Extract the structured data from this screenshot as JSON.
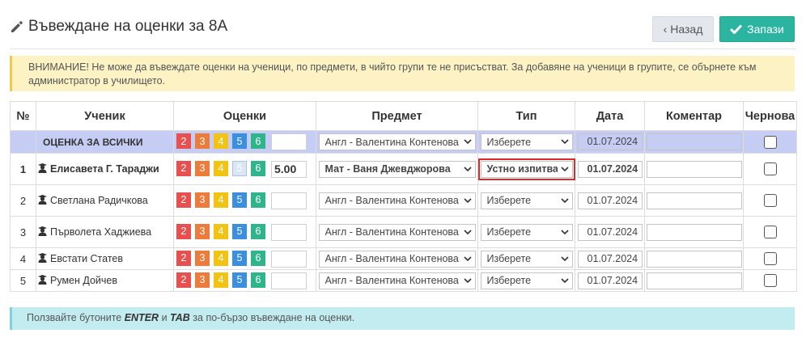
{
  "header": {
    "title": "Въвеждане на оценки за 8А",
    "back_label": "Назад",
    "save_label": "Запази"
  },
  "warning": "ВНИМАНИЕ! Не може да въвеждате оценки на ученици, по предмети, в чийто групи те не присъстват. За добавяне на ученици в групите, се обърнете към администратор в училището.",
  "table": {
    "headers": [
      "№",
      "Ученик",
      "Оценки",
      "Предмет",
      "Тип",
      "Дата",
      "Коментар",
      "Чернова"
    ],
    "grade_buttons": [
      "2",
      "3",
      "4",
      "5",
      "6"
    ],
    "all_row": {
      "label": "ОЦЕНКА ЗА ВСИЧКИ",
      "grade_value": "",
      "subject": "Англ - Валентина Контенова",
      "type": "Изберете",
      "date": "01.07.2024",
      "comment": ""
    },
    "rows": [
      {
        "num": "1",
        "name": "Елисавета Г. Тараджи",
        "grade_value": "5.00",
        "subject": "Мат - Ваня Джевджорова",
        "type": "Устно изпитване",
        "date": "01.07.2024",
        "comment": ""
      },
      {
        "num": "2",
        "name": "Светлана Радичкова",
        "grade_value": "",
        "subject": "Англ - Валентина Контенова",
        "type": "Изберете",
        "date": "01.07.2024",
        "comment": ""
      },
      {
        "num": "3",
        "name": "Първолета Хаджиева",
        "grade_value": "",
        "subject": "Англ - Валентина Контенова",
        "type": "Изберете",
        "date": "01.07.2024",
        "comment": ""
      },
      {
        "num": "4",
        "name": "Евстати Статев",
        "grade_value": "",
        "subject": "Англ - Валентина Контенова",
        "type": "Изберете",
        "date": "01.07.2024",
        "comment": ""
      },
      {
        "num": "5",
        "name": "Румен Дойчев",
        "grade_value": "",
        "subject": "Англ - Валентина Контенова",
        "type": "Изберете",
        "date": "01.07.2024",
        "comment": ""
      }
    ]
  },
  "info": {
    "prefix": "Ползвайте бутоните",
    "key1": "ENTER",
    "and": "и",
    "key2": "TAB",
    "suffix": "за по-бързо въвеждане на оценки."
  },
  "colors": {
    "grade_2": "#e84f4f",
    "grade_3": "#ef7b3b",
    "grade_4": "#f2c313",
    "grade_5": "#3b8fe0",
    "grade_6": "#2fb58c",
    "save_button": "#2bb5a0",
    "all_row_bg": "#c6cdf4",
    "warning_bg": "#fcf2c4",
    "info_bg": "#c3ecf0",
    "highlight": "#e02828"
  },
  "icons": {
    "title": "pencil-icon",
    "back": "chevron-left-icon",
    "save": "check-icon",
    "student": "student-icon",
    "select": "chevron-down-icon"
  }
}
